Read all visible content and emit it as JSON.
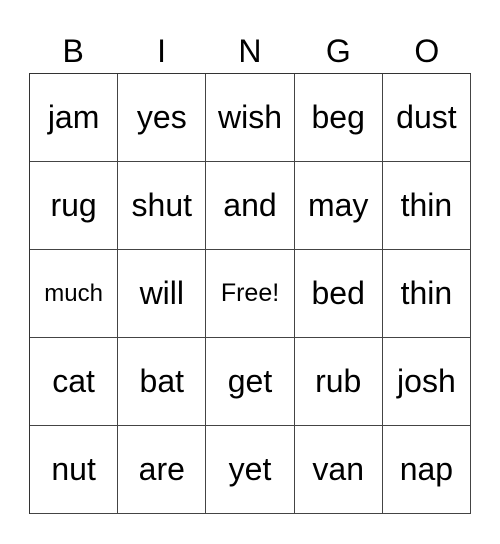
{
  "header": [
    "B",
    "I",
    "N",
    "G",
    "O"
  ],
  "grid": [
    [
      "jam",
      "yes",
      "wish",
      "beg",
      "dust"
    ],
    [
      "rug",
      "shut",
      "and",
      "may",
      "thin"
    ],
    [
      "much",
      "will",
      "Free!",
      "bed",
      "thin"
    ],
    [
      "cat",
      "bat",
      "get",
      "rub",
      "josh"
    ],
    [
      "nut",
      "are",
      "yet",
      "van",
      "nap"
    ]
  ],
  "free_space": {
    "row": 2,
    "col": 2,
    "label": "Free!"
  },
  "colors": {
    "text": "#000000",
    "grid_line": "#444444",
    "background": "#ffffff"
  }
}
